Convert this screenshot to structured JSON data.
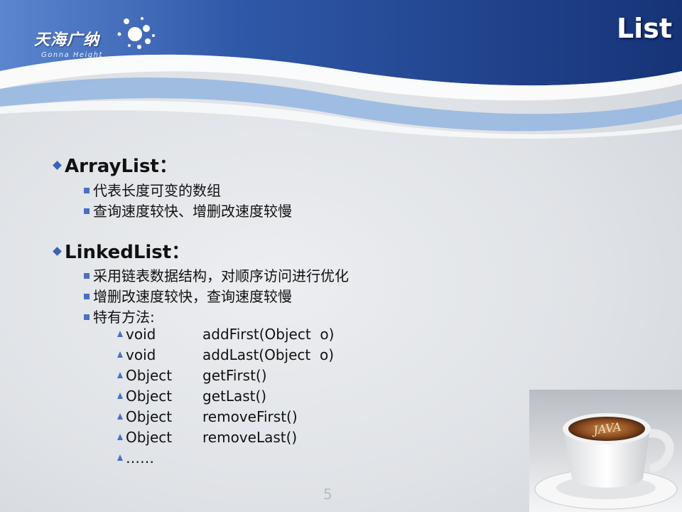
{
  "header": {
    "logo_cn": "天海广纳",
    "logo_en": "Gonna Height",
    "title": "List"
  },
  "sections": [
    {
      "heading": "ArrayList：",
      "items": [
        "代表长度可变的数组",
        "查询速度较快、增删改速度较慢"
      ]
    },
    {
      "heading": "LinkedList：",
      "items": [
        "采用链表数据结构，对顺序访问进行优化",
        "增删改速度较快，查询速度较慢",
        "特有方法:"
      ],
      "methods": [
        {
          "ret": "void",
          "sig": "addFirst(Object  o)"
        },
        {
          "ret": "void",
          "sig": "addLast(Object  o)"
        },
        {
          "ret": "Object",
          "sig": "getFirst()"
        },
        {
          "ret": "Object",
          "sig": "getLast()"
        },
        {
          "ret": "Object",
          "sig": "removeFirst()"
        },
        {
          "ret": "Object",
          "sig": "removeLast()"
        },
        {
          "ret": "……",
          "sig": ""
        }
      ]
    }
  ],
  "page_number": "5",
  "image": {
    "cup_label": "JAVA"
  },
  "colors": {
    "header_blue": "#1f3f8f",
    "bullet_blue": "#3a62b8",
    "wave_light": "#8fb3e0"
  }
}
